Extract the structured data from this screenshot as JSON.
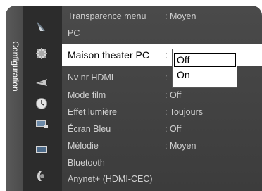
{
  "sidebar": {
    "title": "Configuration"
  },
  "menu": {
    "rows": [
      {
        "label": "Transparence menu",
        "value": ": Moyen"
      },
      {
        "label": "PC",
        "value": ""
      },
      {
        "label": "Nv nr HDMI",
        "value": ":"
      },
      {
        "label": "Mode film",
        "value": ": Off"
      },
      {
        "label": "Effet lumière",
        "value": ": Toujours"
      },
      {
        "label": "Écran Bleu",
        "value": ": Off"
      },
      {
        "label": "Mélodie",
        "value": ": Moyen"
      },
      {
        "label": "Bluetooth",
        "value": ""
      },
      {
        "label": "Anynet+ (HDMI-CEC)",
        "value": ""
      }
    ],
    "highlighted": {
      "label": "Maison theater PC",
      "colon": ":"
    }
  },
  "dropdown": {
    "options": [
      "Off",
      "On"
    ],
    "selected": "Off"
  },
  "icons": [
    "satellite-dish-icon",
    "gear-setup-icon",
    "antenna-icon",
    "clock-icon",
    "tv-input-icon",
    "tv-picture-icon",
    "channel-icon"
  ]
}
